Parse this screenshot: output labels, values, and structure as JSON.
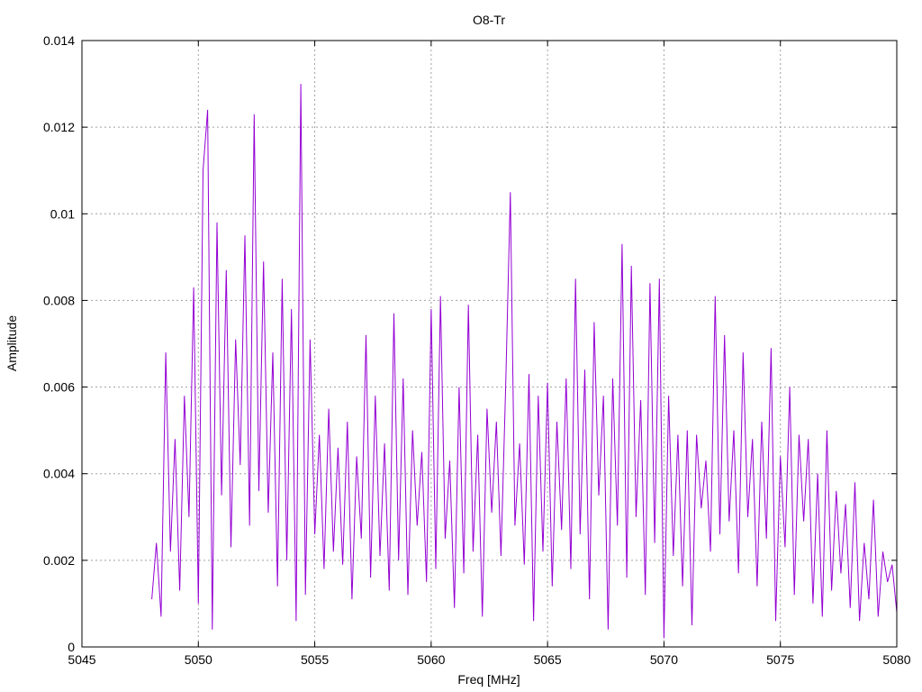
{
  "chart_data": {
    "type": "line",
    "title": "O8-Tr",
    "xlabel": "Freq [MHz]",
    "ylabel": "Amplitude",
    "xlim": [
      5045,
      5080
    ],
    "ylim": [
      0,
      0.014
    ],
    "grid": true,
    "xticks": [
      "5045",
      "5050",
      "5055",
      "5060",
      "5065",
      "5070",
      "5075",
      "5080"
    ],
    "xtick_values": [
      5045,
      5050,
      5055,
      5060,
      5065,
      5070,
      5075,
      5080
    ],
    "yticks": [
      "0",
      "0.002",
      "0.004",
      "0.006",
      "0.008",
      "0.01",
      "0.012",
      "0.014"
    ],
    "ytick_values": [
      0,
      0.002,
      0.004,
      0.006,
      0.008,
      0.01,
      0.012,
      0.014
    ],
    "series": [
      {
        "name": "O8-Tr",
        "color": "#9400d3",
        "x_start": 5048.0,
        "x_step": 0.2,
        "values": [
          0.0011,
          0.0024,
          0.0007,
          0.0068,
          0.0022,
          0.0048,
          0.0013,
          0.0058,
          0.003,
          0.0083,
          0.001,
          0.011,
          0.0124,
          0.0004,
          0.0098,
          0.0035,
          0.0087,
          0.0023,
          0.0071,
          0.0042,
          0.0095,
          0.0028,
          0.0123,
          0.0036,
          0.0089,
          0.0031,
          0.0068,
          0.0014,
          0.0085,
          0.002,
          0.0078,
          0.0006,
          0.013,
          0.0012,
          0.0071,
          0.0026,
          0.0049,
          0.0018,
          0.0055,
          0.0022,
          0.0046,
          0.0019,
          0.0052,
          0.0011,
          0.0044,
          0.0025,
          0.0072,
          0.0016,
          0.0058,
          0.0021,
          0.0047,
          0.0013,
          0.0077,
          0.002,
          0.0062,
          0.0012,
          0.005,
          0.0028,
          0.0045,
          0.0015,
          0.0078,
          0.0018,
          0.0081,
          0.0025,
          0.0043,
          0.0009,
          0.006,
          0.0017,
          0.0079,
          0.0022,
          0.0049,
          0.0007,
          0.0055,
          0.0031,
          0.0052,
          0.0021,
          0.006,
          0.0105,
          0.0028,
          0.0047,
          0.0019,
          0.0063,
          0.0006,
          0.0058,
          0.0022,
          0.0061,
          0.0014,
          0.0052,
          0.0027,
          0.0062,
          0.0018,
          0.0085,
          0.0026,
          0.0064,
          0.0011,
          0.0075,
          0.0035,
          0.0058,
          0.0004,
          0.0062,
          0.0028,
          0.0093,
          0.0016,
          0.0088,
          0.003,
          0.0057,
          0.0012,
          0.0084,
          0.0024,
          0.0085,
          0.0002,
          0.0058,
          0.0021,
          0.0049,
          0.0014,
          0.005,
          0.0005,
          0.0049,
          0.0032,
          0.0043,
          0.0022,
          0.0081,
          0.0026,
          0.0072,
          0.0029,
          0.005,
          0.0017,
          0.0068,
          0.003,
          0.0048,
          0.0014,
          0.0052,
          0.0025,
          0.0069,
          0.0006,
          0.0044,
          0.0023,
          0.006,
          0.0012,
          0.0049,
          0.0029,
          0.0048,
          0.001,
          0.004,
          0.0007,
          0.005,
          0.0013,
          0.0036,
          0.0017,
          0.0033,
          0.0009,
          0.0038,
          0.0006,
          0.0024,
          0.0011,
          0.0034,
          0.0007,
          0.0022,
          0.0015,
          0.0019,
          0.0008
        ]
      }
    ]
  }
}
